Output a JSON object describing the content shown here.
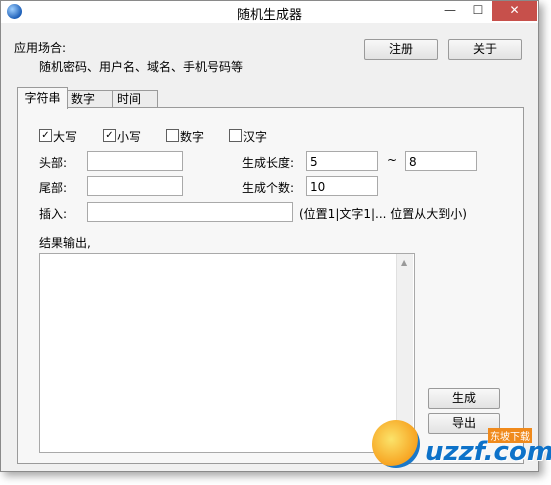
{
  "window": {
    "title": "随机生成器",
    "min_symbol": "—",
    "max_symbol": "☐",
    "close_symbol": "✕"
  },
  "header": {
    "usage_label": "应用场合:",
    "usage_desc": "随机密码、用户名、域名、手机号码等",
    "register_label": "注册",
    "about_label": "关于"
  },
  "tabs": [
    {
      "label": "字符串",
      "active": true
    },
    {
      "label": "数字",
      "active": false
    },
    {
      "label": "时间",
      "active": false
    }
  ],
  "options": [
    {
      "label": "大写",
      "checked": true,
      "mark": "✓"
    },
    {
      "label": "小写",
      "checked": true,
      "mark": "✓"
    },
    {
      "label": "数字",
      "checked": false,
      "mark": ""
    },
    {
      "label": "汉字",
      "checked": false,
      "mark": ""
    }
  ],
  "form": {
    "head_label": "头部:",
    "head_value": "",
    "tail_label": "尾部:",
    "tail_value": "",
    "insert_label": "插入:",
    "insert_value": "",
    "insert_hint": "(位置1|文字1|... 位置从大到小)",
    "length_label": "生成长度:",
    "length_min": "5",
    "range_sep": "~",
    "length_max": "8",
    "count_label": "生成个数:",
    "count_value": "10"
  },
  "output": {
    "label": "结果输出,",
    "value": ""
  },
  "actions": {
    "generate_label": "生成",
    "export_label": "导出"
  },
  "watermark": {
    "text": "uzzf.com",
    "badge": "东坡下载"
  }
}
